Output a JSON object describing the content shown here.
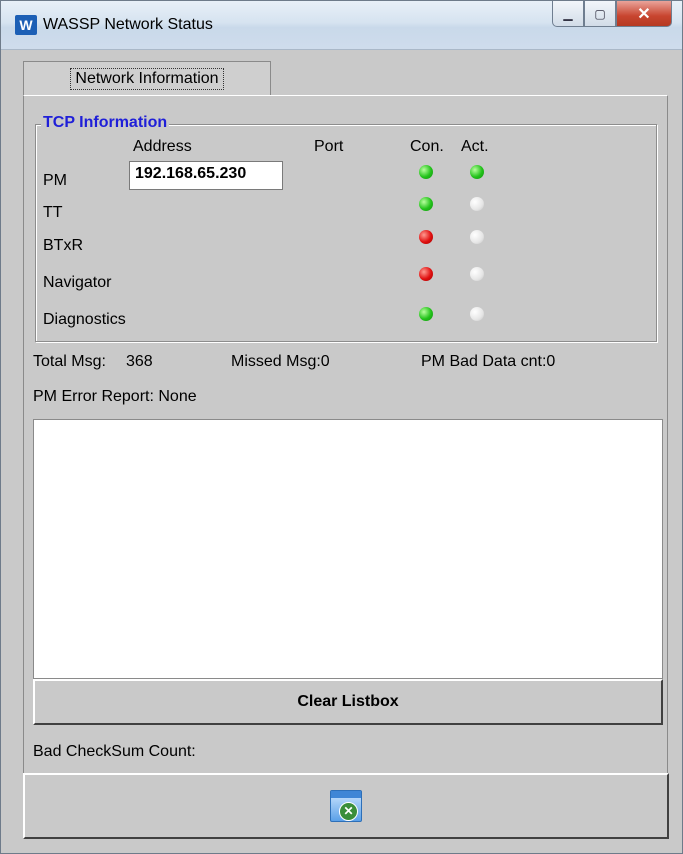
{
  "window": {
    "title": "WASSP Network Status",
    "app_icon_letter": "W"
  },
  "tabs": [
    {
      "label": "Network Information"
    }
  ],
  "tcp": {
    "group_title": "TCP Information",
    "headers": {
      "address": "Address",
      "port": "Port",
      "con": "Con.",
      "act": "Act."
    },
    "pm_address": "192.168.65.230",
    "rows": [
      {
        "name": "PM",
        "con": "green",
        "act": "green"
      },
      {
        "name": "TT",
        "con": "green",
        "act": "off"
      },
      {
        "name": "BTxR",
        "con": "red",
        "act": "off"
      },
      {
        "name": "Navigator",
        "con": "red",
        "act": "off"
      },
      {
        "name": "Diagnostics",
        "con": "green",
        "act": "off"
      }
    ]
  },
  "stats": {
    "total_msg_label": "Total Msg:",
    "total_msg_value": "368",
    "missed_msg": "Missed Msg:0",
    "pm_bad_data": "PM Bad Data cnt:0",
    "pm_error_report": "PM Error Report: None"
  },
  "buttons": {
    "clear_listbox": "Clear Listbox"
  },
  "bad_checksum": "Bad CheckSum Count:",
  "colors": {
    "group_title": "#1f1fd8",
    "led_green": "#22c21a",
    "led_red": "#e01010",
    "led_off": "#e6e6e6"
  },
  "icons": {
    "exit": "exit-app-icon"
  }
}
